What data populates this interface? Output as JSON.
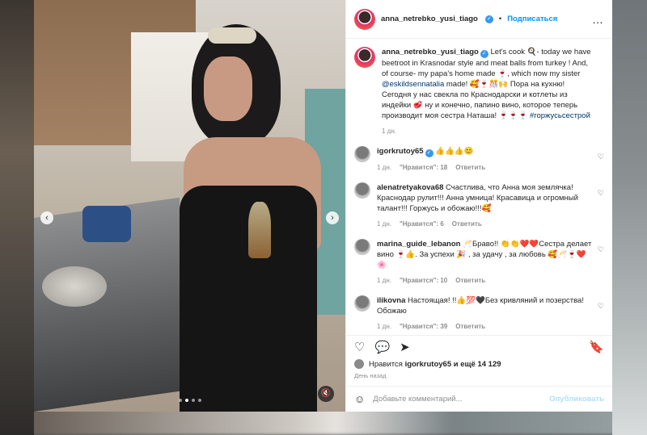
{
  "post": {
    "username": "anna_netrebko_yusi_tiago",
    "follow_label": "Подписаться",
    "more_icon": "…",
    "caption_text_1": "Let's cook 🍳- today we have beetroot in Krasnodar style and meat balls from turkey ! And, of course- my papa's home made 🍷, which now my sister ",
    "caption_mention": "@eskildsennatalia",
    "caption_text_2": " made! 🥰🍷🎊🙌 Пора на кухню! Сегодня у нас свекла по Краснодарски и котлеты из индейки 🥩 ну и конечно, папино вино, которое теперь производит моя сестра Наташа! 🍷🍷🍷 ",
    "caption_hashtag": "#горжусьсестрой",
    "caption_time": "1 дн."
  },
  "comments": [
    {
      "user": "igorkrutoy65",
      "verified": true,
      "text": "👍👍👍😊",
      "time": "1 дн.",
      "likes": "\"Нравится\": 18",
      "reply": "Ответить"
    },
    {
      "user": "alenatretyakova68",
      "verified": false,
      "text": "Счастлива, что Анна моя землячка! Краснодар рулит!!! Анна умница! Красавица и огромный талант!!! Горжусь и обожаю!!!🥰",
      "time": "1 дн.",
      "likes": "\"Нравится\": 6",
      "reply": "Ответить"
    },
    {
      "user": "marina_guide_lebanon",
      "verified": false,
      "text": "🥂Браво!! 👏👏❤️❤️Сестра делает вино 🍷👍. За успехи 🎉 , за удачу , за любовь 🥰🥂🍷❤️🌸",
      "time": "1 дн.",
      "likes": "\"Нравится\": 10",
      "reply": "Ответить"
    },
    {
      "user": "ilikovna",
      "verified": false,
      "text": "Настоящая! !!👍💯🖤Без кривляний и позерства! Обожаю",
      "time": "1 дн.",
      "likes": "\"Нравится\": 39",
      "reply": "Ответить"
    }
  ],
  "likes_line": {
    "prefix": "Нравится ",
    "user": "igorkrutoy65",
    "suffix": " и ещё 14 129"
  },
  "date_label": "День назад",
  "comment_box": {
    "placeholder": "Добавьте комментарий...",
    "post_label": "Опубликовать"
  },
  "icons": {
    "heart": "♡",
    "comment": "💬",
    "share": "➤",
    "bookmark": "🔖",
    "emoji": "☺",
    "prev": "‹",
    "next": "›",
    "mute": "🔇"
  },
  "colors": {
    "accent": "#0095f6",
    "muted_text": "#8e8e8e"
  }
}
